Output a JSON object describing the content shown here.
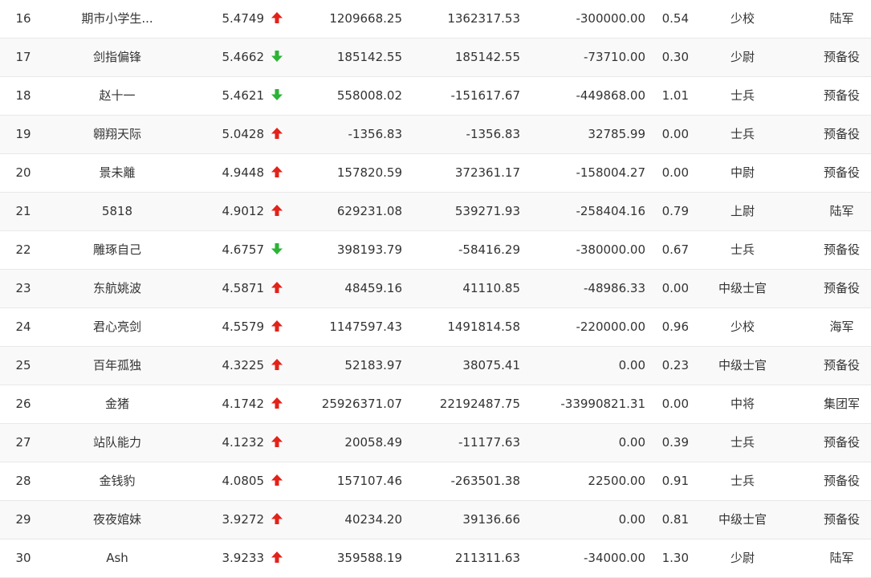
{
  "colors": {
    "up": "#e2231a",
    "down": "#2db336",
    "text": "#333333",
    "row_alt": "#f9f9f9",
    "border": "#e8e8e8"
  },
  "rows": [
    {
      "rank": "16",
      "name": "期市小学生...",
      "score": "5.4749",
      "trend": "up",
      "v1": "1209668.25",
      "v2": "1362317.53",
      "v3": "-300000.00",
      "ratio": "0.54",
      "title": "少校",
      "group": "陆军"
    },
    {
      "rank": "17",
      "name": "剑指偏锋",
      "score": "5.4662",
      "trend": "down",
      "v1": "185142.55",
      "v2": "185142.55",
      "v3": "-73710.00",
      "ratio": "0.30",
      "title": "少尉",
      "group": "预备役"
    },
    {
      "rank": "18",
      "name": "赵十一",
      "score": "5.4621",
      "trend": "down",
      "v1": "558008.02",
      "v2": "-151617.67",
      "v3": "-449868.00",
      "ratio": "1.01",
      "title": "士兵",
      "group": "预备役"
    },
    {
      "rank": "19",
      "name": "翱翔天际",
      "score": "5.0428",
      "trend": "up",
      "v1": "-1356.83",
      "v2": "-1356.83",
      "v3": "32785.99",
      "ratio": "0.00",
      "title": "士兵",
      "group": "预备役"
    },
    {
      "rank": "20",
      "name": "景未離",
      "score": "4.9448",
      "trend": "up",
      "v1": "157820.59",
      "v2": "372361.17",
      "v3": "-158004.27",
      "ratio": "0.00",
      "title": "中尉",
      "group": "预备役"
    },
    {
      "rank": "21",
      "name": "5818",
      "score": "4.9012",
      "trend": "up",
      "v1": "629231.08",
      "v2": "539271.93",
      "v3": "-258404.16",
      "ratio": "0.79",
      "title": "上尉",
      "group": "陆军"
    },
    {
      "rank": "22",
      "name": "雕琢自己",
      "score": "4.6757",
      "trend": "down",
      "v1": "398193.79",
      "v2": "-58416.29",
      "v3": "-380000.00",
      "ratio": "0.67",
      "title": "士兵",
      "group": "预备役"
    },
    {
      "rank": "23",
      "name": "东航姚波",
      "score": "4.5871",
      "trend": "up",
      "v1": "48459.16",
      "v2": "41110.85",
      "v3": "-48986.33",
      "ratio": "0.00",
      "title": "中级士官",
      "group": "预备役"
    },
    {
      "rank": "24",
      "name": "君心亮剑",
      "score": "4.5579",
      "trend": "up",
      "v1": "1147597.43",
      "v2": "1491814.58",
      "v3": "-220000.00",
      "ratio": "0.96",
      "title": "少校",
      "group": "海军"
    },
    {
      "rank": "25",
      "name": "百年孤独",
      "score": "4.3225",
      "trend": "up",
      "v1": "52183.97",
      "v2": "38075.41",
      "v3": "0.00",
      "ratio": "0.23",
      "title": "中级士官",
      "group": "预备役"
    },
    {
      "rank": "26",
      "name": "金猪",
      "score": "4.1742",
      "trend": "up",
      "v1": "25926371.07",
      "v2": "22192487.75",
      "v3": "-33990821.31",
      "ratio": "0.00",
      "title": "中将",
      "group": "集团军"
    },
    {
      "rank": "27",
      "name": "站队能力",
      "score": "4.1232",
      "trend": "up",
      "v1": "20058.49",
      "v2": "-11177.63",
      "v3": "0.00",
      "ratio": "0.39",
      "title": "士兵",
      "group": "预备役"
    },
    {
      "rank": "28",
      "name": "金钱豹",
      "score": "4.0805",
      "trend": "up",
      "v1": "157107.46",
      "v2": "-263501.38",
      "v3": "22500.00",
      "ratio": "0.91",
      "title": "士兵",
      "group": "预备役"
    },
    {
      "rank": "29",
      "name": "夜夜婠妹",
      "score": "3.9272",
      "trend": "up",
      "v1": "40234.20",
      "v2": "39136.66",
      "v3": "0.00",
      "ratio": "0.81",
      "title": "中级士官",
      "group": "预备役"
    },
    {
      "rank": "30",
      "name": "Ash",
      "score": "3.9233",
      "trend": "up",
      "v1": "359588.19",
      "v2": "211311.63",
      "v3": "-34000.00",
      "ratio": "1.30",
      "title": "少尉",
      "group": "陆军"
    }
  ]
}
